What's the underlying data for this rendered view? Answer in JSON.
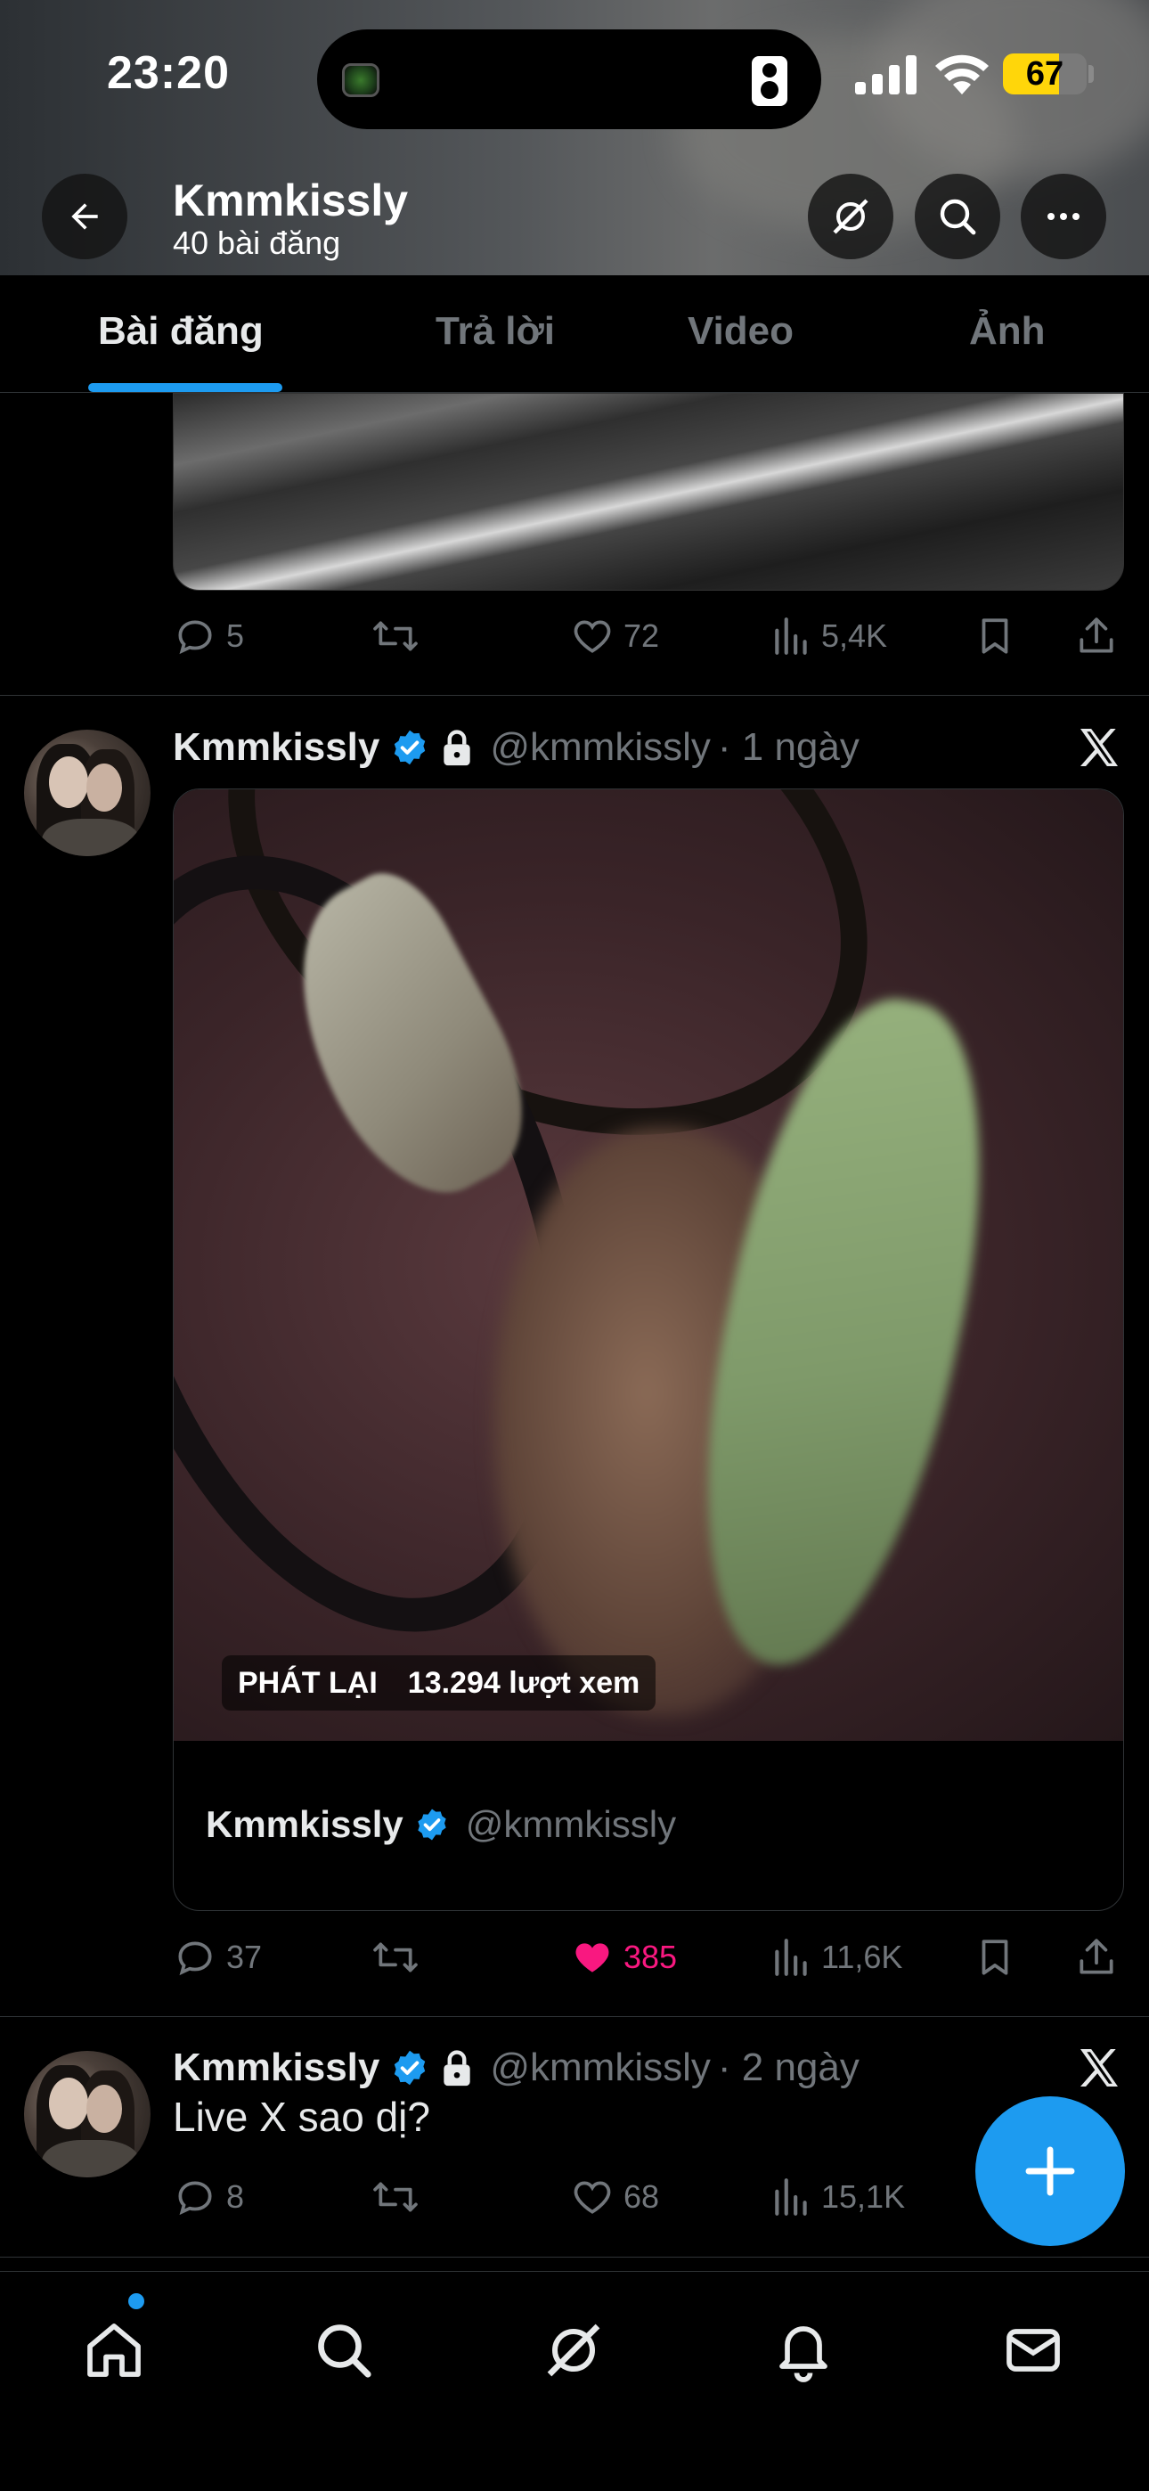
{
  "status_bar": {
    "time": "23:20",
    "battery": "67",
    "battery_level": 0.67
  },
  "header": {
    "back_icon": "arrow-left-icon",
    "title": "Kmmkissly",
    "subtitle": "40 bài đăng",
    "buttons": [
      "grok-icon",
      "search-icon",
      "more-icon"
    ]
  },
  "tabs": [
    {
      "label": "Bài đăng",
      "active": true
    },
    {
      "label": "Trả lời",
      "active": false
    },
    {
      "label": "Video",
      "active": false
    },
    {
      "label": "Ảnh",
      "active": false
    }
  ],
  "posts": [
    {
      "replies": "5",
      "reposts": "",
      "likes": "72",
      "views": "5,4K",
      "liked": false
    },
    {
      "name": "Kmmkissly",
      "handle": "@kmmkissly",
      "time": "· 1 ngày",
      "verified": true,
      "protected": true,
      "video": {
        "replay_label": "PHÁT LẠI",
        "views_label": "13.294 lượt xem",
        "card_name": "Kmmkissly",
        "card_handle": "@kmmkissly"
      },
      "replies": "37",
      "reposts": "",
      "likes": "385",
      "views": "11,6K",
      "liked": true
    },
    {
      "name": "Kmmkissly",
      "handle": "@kmmkissly",
      "time": "· 2 ngày",
      "verified": true,
      "protected": true,
      "text": "Live X sao dị?",
      "replies": "8",
      "reposts": "",
      "likes": "68",
      "views": "15,1K",
      "liked": false
    }
  ],
  "fab": {
    "icon": "plus-icon"
  },
  "bottom_nav": [
    "home-icon",
    "search-icon",
    "grok-icon",
    "notifications-icon",
    "messages-icon"
  ],
  "colors": {
    "accent": "#1d9bf0",
    "like": "#f91880",
    "muted": "#71767b"
  }
}
